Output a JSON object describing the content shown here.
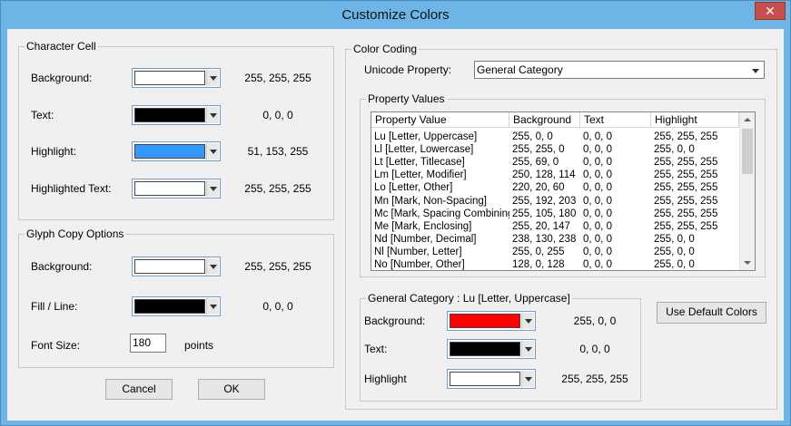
{
  "window": {
    "title": "Customize Colors",
    "close_glyph": "✕"
  },
  "character_cell": {
    "legend": "Character Cell",
    "rows": [
      {
        "label": "Background:",
        "color": "#ffffff",
        "value": "255, 255, 255"
      },
      {
        "label": "Text:",
        "color": "#000000",
        "value": "0, 0, 0"
      },
      {
        "label": "Highlight:",
        "color": "#3399ff",
        "value": "51, 153, 255"
      },
      {
        "label": "Highlighted Text:",
        "color": "#ffffff",
        "value": "255, 255, 255"
      }
    ]
  },
  "glyph_copy": {
    "legend": "Glyph Copy Options",
    "rows": [
      {
        "label": "Background:",
        "color": "#ffffff",
        "value": "255, 255, 255"
      },
      {
        "label": "Fill / Line:",
        "color": "#000000",
        "value": "0, 0, 0"
      }
    ],
    "font_size_label": "Font Size:",
    "font_size_value": "180",
    "font_size_unit": "points"
  },
  "buttons": {
    "cancel": "Cancel",
    "ok": "OK",
    "use_default": "Use Default Colors"
  },
  "color_coding": {
    "legend": "Color Coding",
    "unicode_property_label": "Unicode Property:",
    "unicode_property_value": "General Category",
    "property_values_legend": "Property Values",
    "columns": [
      "Property Value",
      "Background",
      "Text",
      "Highlight"
    ],
    "rows": [
      [
        "Lu [Letter, Uppercase]",
        "255, 0, 0",
        "0, 0, 0",
        "255, 255, 255"
      ],
      [
        "Ll [Letter, Lowercase]",
        "255, 255, 0",
        "0, 0, 0",
        "255, 0, 0"
      ],
      [
        "Lt [Letter, Titlecase]",
        "255, 69, 0",
        "0, 0, 0",
        "255, 255, 255"
      ],
      [
        "Lm [Letter, Modifier]",
        "250, 128, 114",
        "0, 0, 0",
        "255, 255, 255"
      ],
      [
        "Lo [Letter, Other]",
        "220, 20, 60",
        "0, 0, 0",
        "255, 255, 255"
      ],
      [
        "Mn [Mark, Non-Spacing]",
        "255, 192, 203",
        "0, 0, 0",
        "255, 255, 255"
      ],
      [
        "Mc [Mark, Spacing Combining]",
        "255, 105, 180",
        "0, 0, 0",
        "255, 255, 255"
      ],
      [
        "Me [Mark, Enclosing]",
        "255, 20, 147",
        "0, 0, 0",
        "255, 255, 255"
      ],
      [
        "Nd [Number, Decimal]",
        "238, 130, 238",
        "0, 0, 0",
        "255, 0, 0"
      ],
      [
        "Nl [Number, Letter]",
        "255, 0, 255",
        "0, 0, 0",
        "255, 0, 0"
      ],
      [
        "No [Number, Other]",
        "128, 0, 128",
        "0, 0, 0",
        "255, 0, 0"
      ]
    ],
    "general_category": {
      "legend": "General Category : Lu [Letter, Uppercase]",
      "rows": [
        {
          "label": "Background:",
          "color": "#ff0000",
          "value": "255, 0, 0"
        },
        {
          "label": "Text:",
          "color": "#000000",
          "value": "0, 0, 0"
        },
        {
          "label": "Highlight",
          "color": "#ffffff",
          "value": "255, 255, 255"
        }
      ]
    }
  }
}
